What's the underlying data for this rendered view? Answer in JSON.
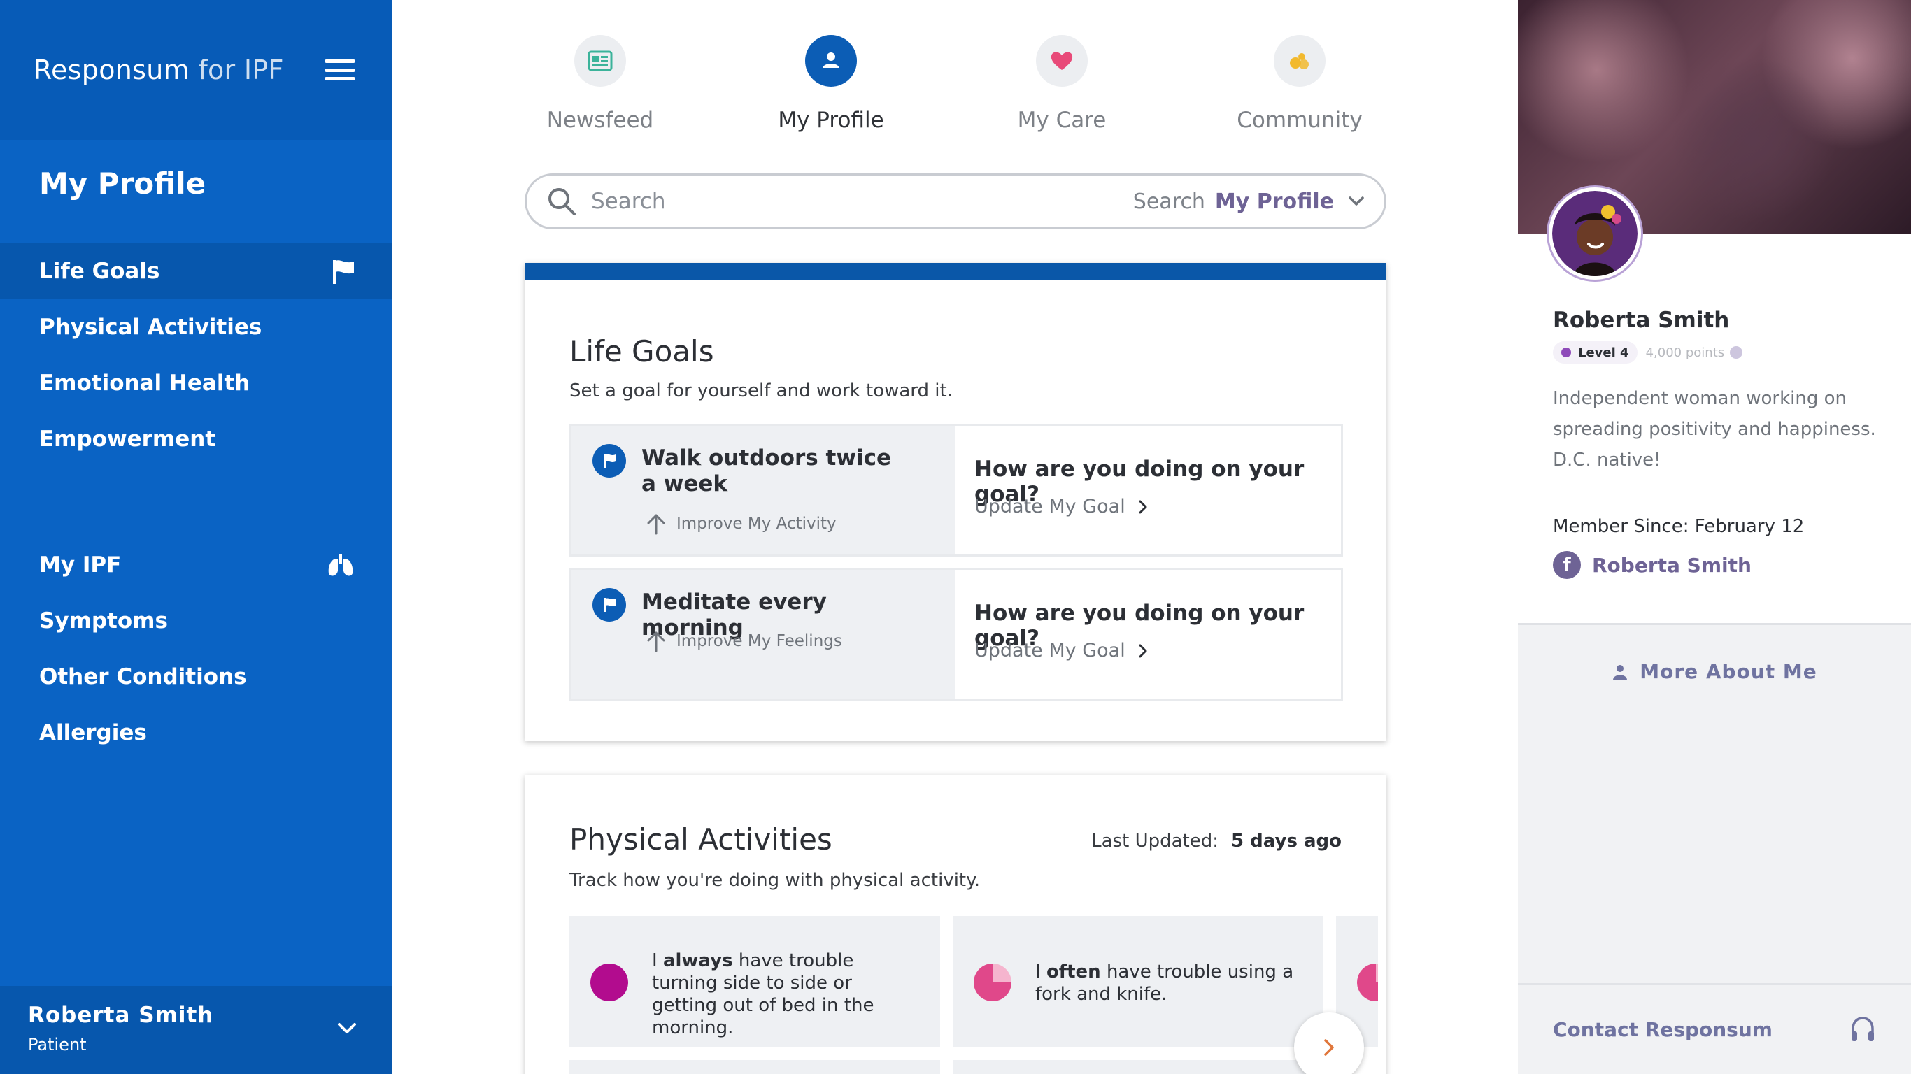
{
  "sidebar": {
    "brand_main": "Responsum",
    "brand_suffix": " for IPF",
    "section_title": "My Profile",
    "profile_items": [
      "Life Goals",
      "Physical Activities",
      "Emotional Health",
      "Empowerment"
    ],
    "ipf_items": [
      "My IPF",
      "Symptoms",
      "Other Conditions",
      "Allergies"
    ],
    "user": {
      "name": "Roberta Smith",
      "role": "Patient"
    }
  },
  "tabs": [
    {
      "label": "Newsfeed",
      "icon": "newsfeed-icon"
    },
    {
      "label": "My Profile",
      "icon": "user-icon"
    },
    {
      "label": "My Care",
      "icon": "heart-icon"
    },
    {
      "label": "Community",
      "icon": "community-icon"
    }
  ],
  "search": {
    "placeholder": "Search",
    "scope_label": "Search",
    "scope_value": "My Profile"
  },
  "life_goals": {
    "title": "Life Goals",
    "subtitle": "Set a goal for yourself and work toward it.",
    "goals": [
      {
        "title": "Walk outdoors twice a week",
        "category": "Improve My Activity",
        "question": "How are you doing on your goal?",
        "action": "Update My Goal"
      },
      {
        "title": "Meditate every morning",
        "category": "Improve My Feelings",
        "question": "How are you doing on your goal?",
        "action": "Update My Goal"
      }
    ]
  },
  "physical_activities": {
    "title": "Physical Activities",
    "subtitle": "Track how you're doing with physical activity.",
    "last_updated_label": "Last Updated:",
    "last_updated_value": "5 days ago",
    "items": [
      {
        "pre": "I ",
        "emphasis": "always",
        "post": " have trouble turning side to side or getting out of bed in the morning."
      },
      {
        "pre": "I ",
        "emphasis": "often",
        "post": " have trouble using a fork and knife."
      }
    ]
  },
  "profile": {
    "name": "Roberta Smith",
    "level": "Level 4",
    "points": "4,000 points",
    "bio": "Independent woman working on spreading positivity and happiness. D.C. native!",
    "member_since_label": "Member Since:",
    "member_since_value": "February 12",
    "facebook_name": "Roberta Smith",
    "facebook_letter": "f",
    "more_label": "More About Me",
    "contact_label": "Contact Responsum"
  },
  "colors": {
    "sidebar_blue": "#0a63c4",
    "accent_purple": "#6e6395",
    "heart_pink": "#e84a79",
    "community_yellow": "#f2b92e",
    "newsfeed_teal": "#3bb39a"
  }
}
